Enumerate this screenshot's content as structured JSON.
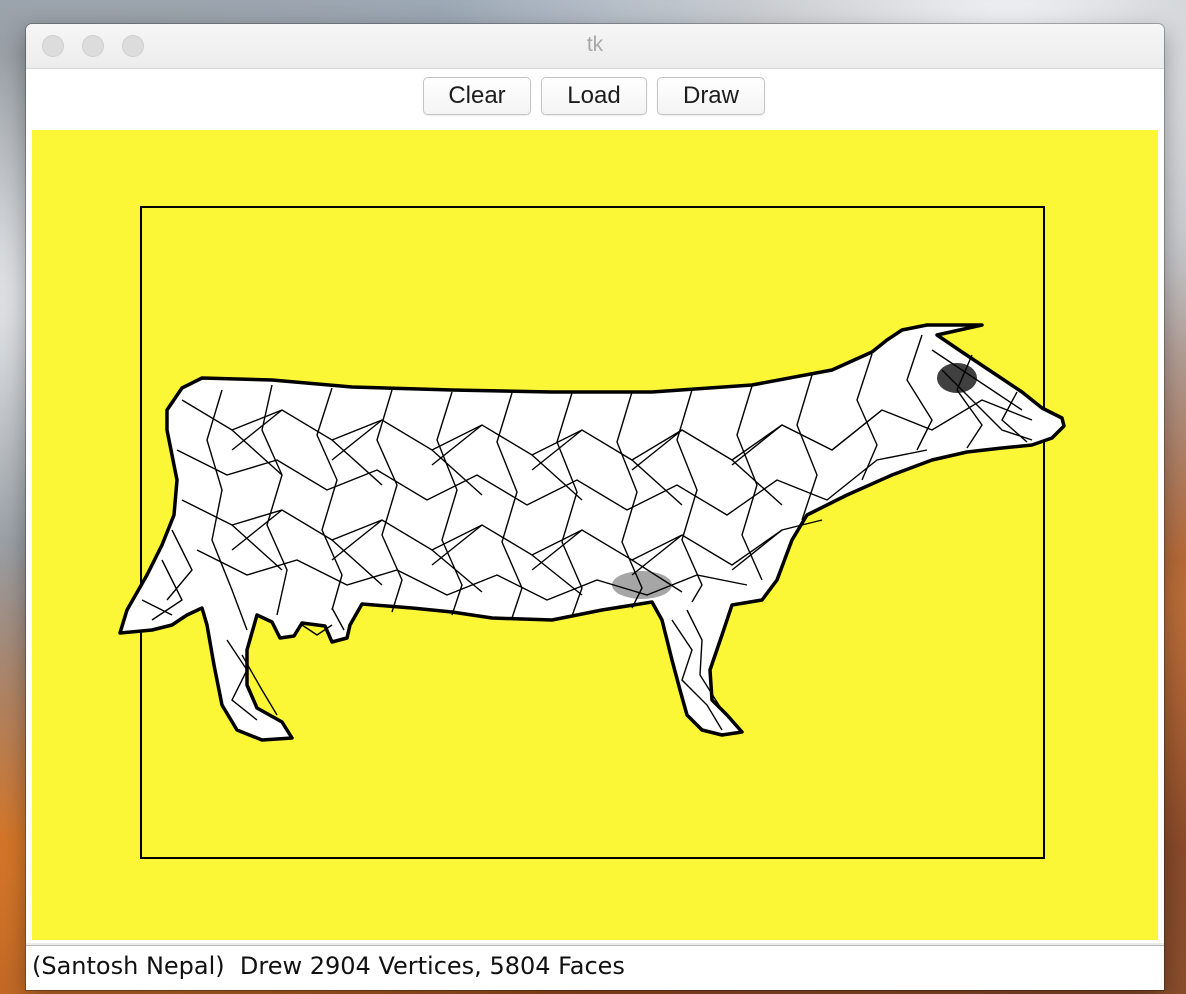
{
  "window": {
    "title": "tk"
  },
  "toolbar": {
    "clear_label": "Clear",
    "load_label": "Load",
    "draw_label": "Draw"
  },
  "canvas": {
    "background_color": "#fcf736",
    "frame_color": "#000000",
    "model": "cow-wireframe-mesh"
  },
  "status": {
    "text": "(Santosh Nepal)  Drew 2904 Vertices, 5804 Faces"
  }
}
